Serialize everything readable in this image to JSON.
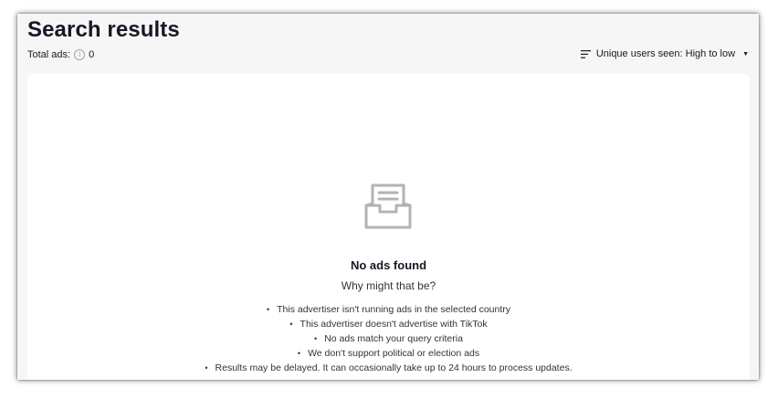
{
  "header": {
    "title": "Search results",
    "total_label": "Total ads:",
    "total_value": "0",
    "sort_label": "Unique users seen: High to low"
  },
  "empty_state": {
    "icon": "inbox-tray-icon",
    "title": "No ads found",
    "subtitle": "Why might that be?",
    "reasons": [
      "This advertiser isn't running ads in the selected country",
      "This advertiser doesn't advertise with TikTok",
      "No ads match your query criteria",
      "We don't support political or election ads",
      "Results may be delayed. It can occasionally take up to 24 hours to process updates."
    ]
  },
  "colors": {
    "background": "#f6f6f6",
    "card": "#ffffff",
    "text": "#161823",
    "icon_gray": "#b3b3b3"
  }
}
